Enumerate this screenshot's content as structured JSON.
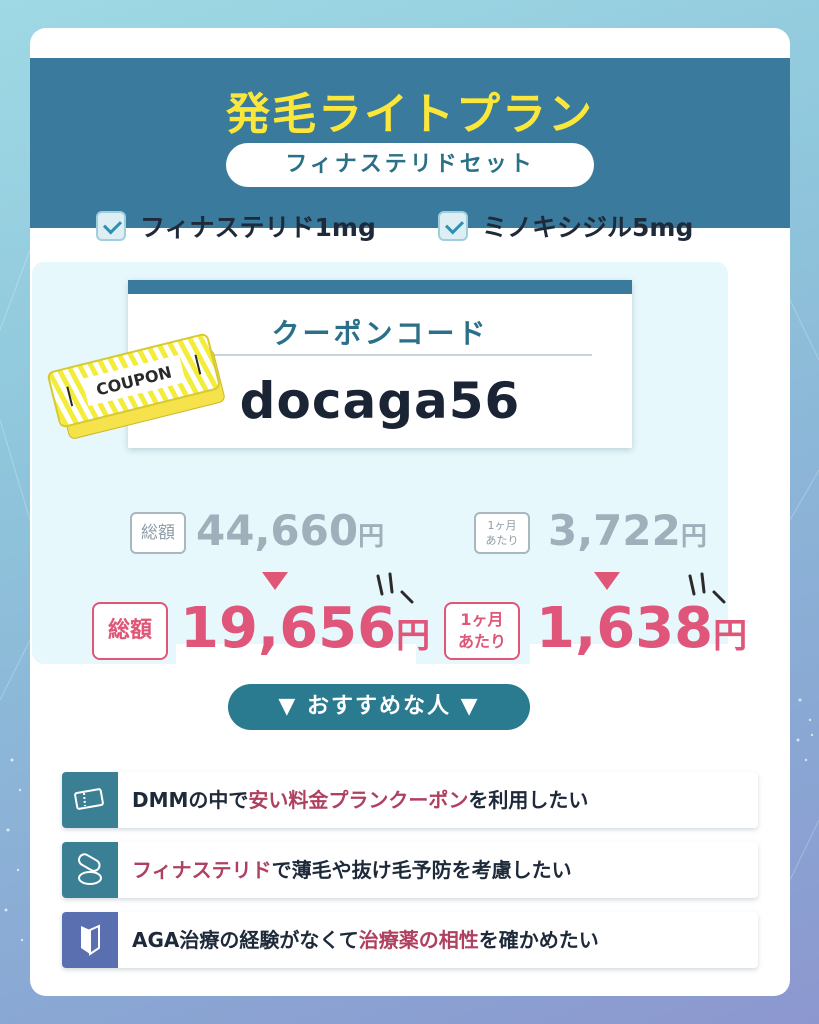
{
  "title": "発毛ライトプラン",
  "subtitle": "フィナステリドセット",
  "included": [
    {
      "label": "フィナステリド1mg",
      "checked": true
    },
    {
      "label": "ミノキシジル5mg",
      "checked": true
    }
  ],
  "coupon": {
    "heading": "クーポンコード",
    "code": "docaga56",
    "ticket_label": "COUPON"
  },
  "pricing": {
    "total": {
      "badge": "総額",
      "old_value": "44,660",
      "new_value": "19,656",
      "currency": "円"
    },
    "monthly": {
      "badge_line1": "1ヶ月",
      "badge_line2": "あたり",
      "old_value": "3,722",
      "new_value": "1,638",
      "currency": "円"
    }
  },
  "recommend": {
    "heading": "▼ おすすめな人 ▼",
    "items": [
      {
        "icon": "coupon-icon",
        "pre": "DMMの中で",
        "highlight": "安い料金プランクーポン",
        "post": "を利用したい"
      },
      {
        "icon": "pill-icon",
        "pre": "",
        "highlight": "フィナステリド",
        "post": "で薄毛や抜け毛予防を考慮したい"
      },
      {
        "icon": "beginner-mark-icon",
        "pre": "AGA治療の経験がなくて",
        "highlight": "治療薬の相性",
        "post": "を確かめたい"
      }
    ]
  },
  "colors": {
    "header": "#3a7a9c",
    "title": "#fbe73a",
    "accent_pink": "#df5677",
    "highlight_text": "#b0405f",
    "teal": "#2a7a90"
  }
}
